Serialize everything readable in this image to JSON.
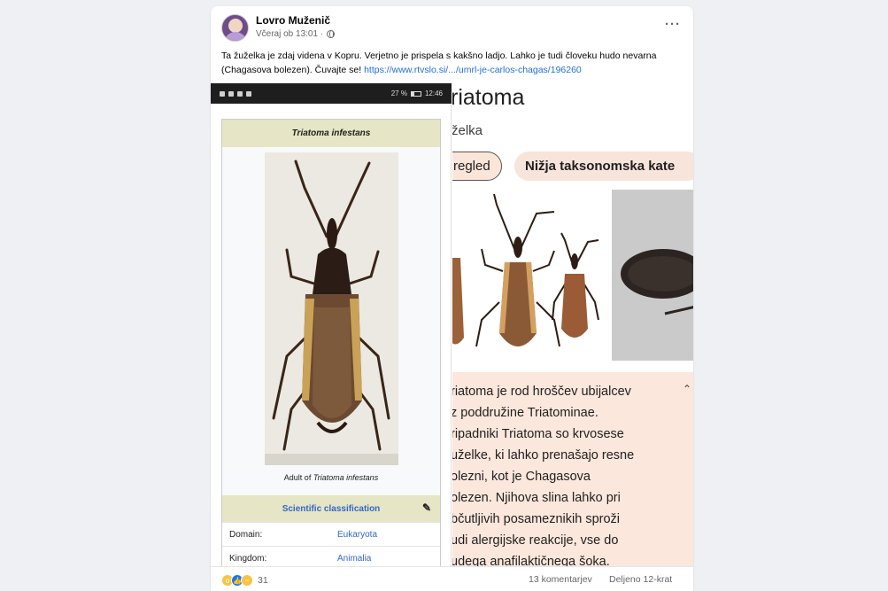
{
  "post": {
    "author": "Lovro Muženič",
    "time": "Včeraj ob 13:01 ·",
    "text": "Ta žuželka je zdaj videna v Kopru. Verjetno je prispela s kakšno ladjo. Lahko je tudi človeku hudo nevarna (Chagasova bolezen). Čuvajte se!",
    "link": "https://www.rtvslo.si/.../umrl-je-carlos-chagas/196260",
    "more_label": "···"
  },
  "phone": {
    "status_left": "",
    "status_right": "27 %",
    "clock": "12:46"
  },
  "infobox": {
    "title": "Triatoma infestans",
    "caption_prefix": "Adult of ",
    "caption_species": "Triatoma infestans",
    "section": "Scientific classification",
    "rows": [
      {
        "key": "Domain:",
        "value": "Eukaryota"
      },
      {
        "key": "Kingdom:",
        "value": "Animalia"
      }
    ]
  },
  "app": {
    "title": "riatoma",
    "subtitle": "želka",
    "chip_overview": "regled",
    "chip_taxa": "Nižja taksonomska kate",
    "description_lines": [
      "riatoma je rod hroščev ubijalcev",
      "z poddružine Triatominae.",
      "ripadniki Triatoma so krvosese",
      "uželke, ki lahko prenašajo resne",
      "olezni, kot je Chagasova",
      "olezen. Njihova slina lahko pri",
      "bčutljivih posameznikih sproži",
      "udi alergijske reakcije, vse do",
      "udega anafilaktičnega šoka."
    ]
  },
  "footer": {
    "reaction_count": "31",
    "comments": "13 komentarjev",
    "shares": "Deljeno 12-krat"
  }
}
